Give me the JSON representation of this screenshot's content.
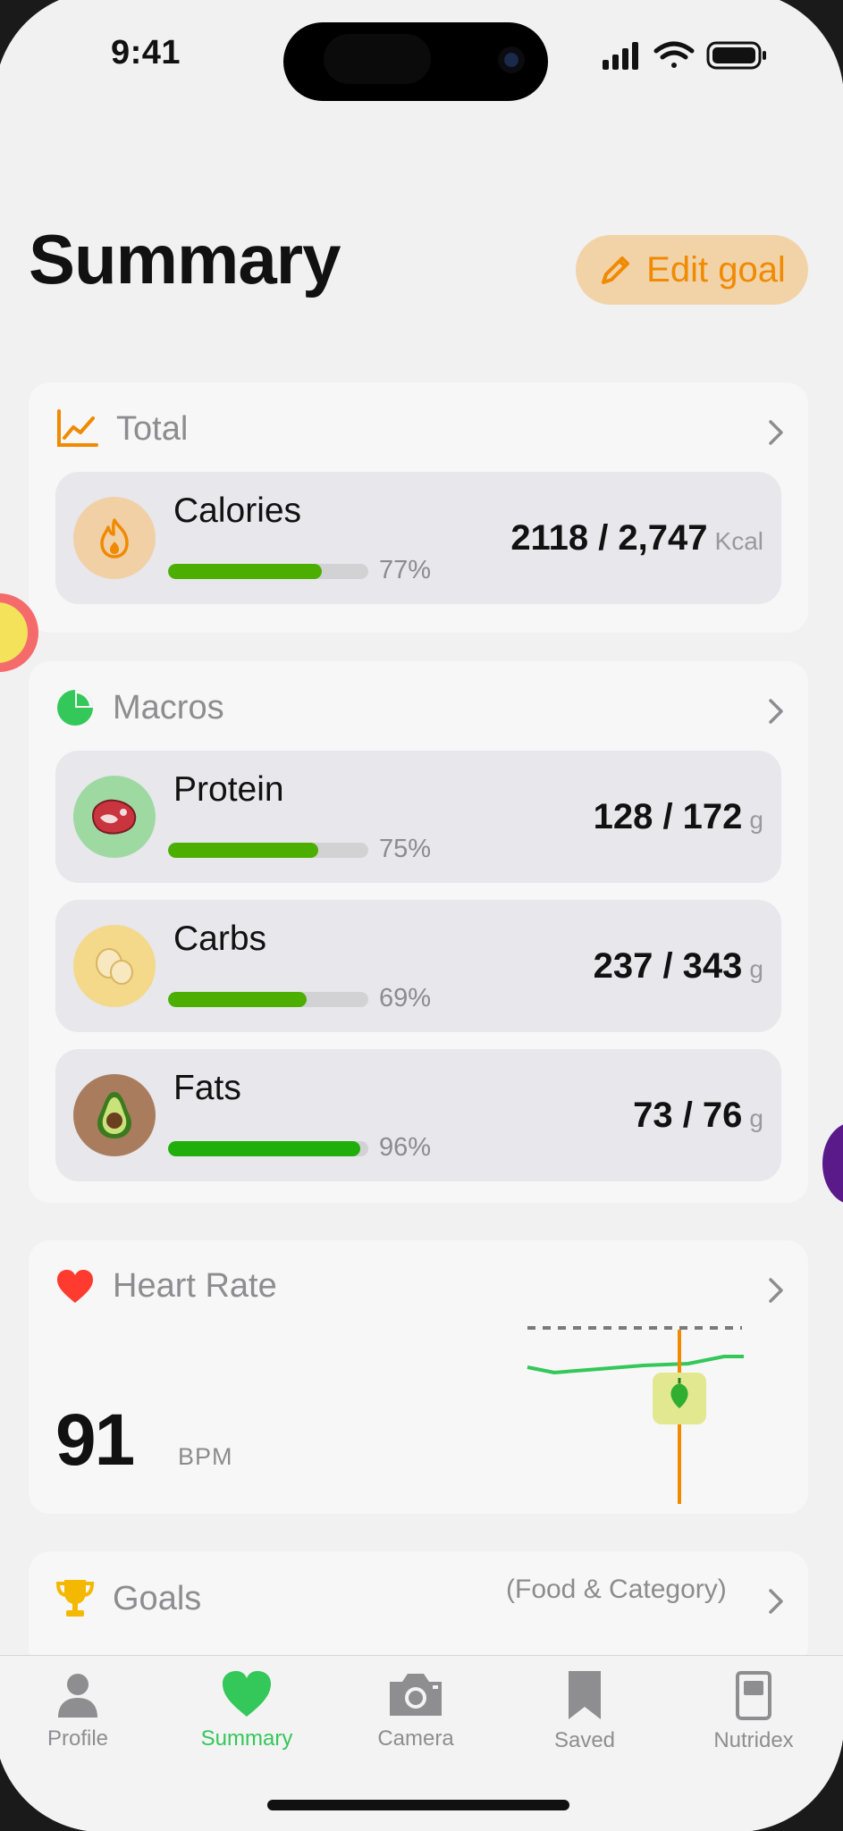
{
  "status_bar": {
    "time": "9:41"
  },
  "header": {
    "title": "Summary",
    "edit_label": "Edit goal"
  },
  "total": {
    "title": "Total",
    "calories": {
      "name": "Calories",
      "percent_label": "77%",
      "progress": 0.77,
      "value": "2118 / 2,747",
      "unit": "Kcal"
    }
  },
  "macros": {
    "title": "Macros",
    "items": [
      {
        "name": "Protein",
        "percent_label": "75%",
        "progress": 0.75,
        "value": "128 / 172",
        "unit": "g"
      },
      {
        "name": "Carbs",
        "percent_label": "69%",
        "progress": 0.69,
        "value": "237 / 343",
        "unit": "g"
      },
      {
        "name": "Fats",
        "percent_label": "96%",
        "progress": 0.96,
        "value": "73 / 76",
        "unit": "g"
      }
    ]
  },
  "heart_rate": {
    "title": "Heart Rate",
    "value": "91",
    "unit": "BPM"
  },
  "goals": {
    "title": "Goals",
    "subtitle": "(Food & Category)"
  },
  "tabs": [
    {
      "label": "Profile",
      "icon": "person-icon"
    },
    {
      "label": "Summary",
      "icon": "heart-icon",
      "active": true
    },
    {
      "label": "Camera",
      "icon": "camera-icon"
    },
    {
      "label": "Saved",
      "icon": "bookmark-icon"
    },
    {
      "label": "Nutridex",
      "icon": "device-icon"
    }
  ],
  "colors": {
    "accent_orange": "#f08a00",
    "progress_green": "#4caf00",
    "active_tab": "#34c759",
    "heart_red": "#ff3b30"
  }
}
